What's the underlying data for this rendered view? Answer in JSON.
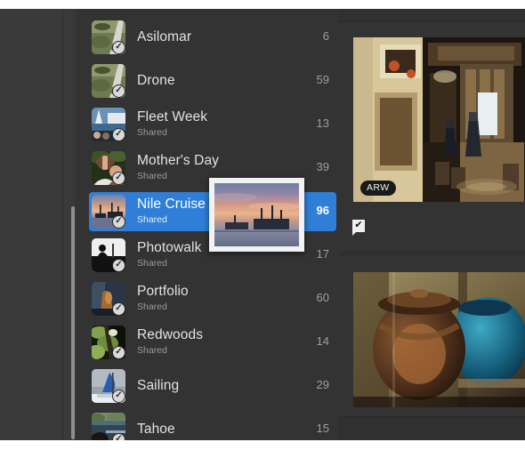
{
  "app": {
    "theme_bg": "#333333",
    "accent": "#2f7fd8",
    "panel_bg": "#3a3a3a"
  },
  "sidebar": {
    "name": "album-list",
    "scrollbar": {
      "name": "vertical-scrollbar"
    },
    "albums": [
      {
        "title": "Asilomar",
        "subtitle": "",
        "count": "6",
        "selected": false,
        "shared_check": true,
        "thumb": "trail"
      },
      {
        "title": "Drone",
        "subtitle": "",
        "count": "59",
        "selected": false,
        "shared_check": true,
        "thumb": "trail"
      },
      {
        "title": "Fleet Week",
        "subtitle": "Shared",
        "count": "13",
        "selected": false,
        "shared_check": true,
        "thumb": "boat"
      },
      {
        "title": "Mother's Day",
        "subtitle": "Shared",
        "count": "39",
        "selected": false,
        "shared_check": true,
        "thumb": "portrait"
      },
      {
        "title": "Nile Cruise",
        "subtitle": "Shared",
        "count": "96",
        "selected": true,
        "shared_check": true,
        "thumb": "sunsetboat"
      },
      {
        "title": "Photowalk",
        "subtitle": "Shared",
        "count": "17",
        "selected": false,
        "shared_check": true,
        "thumb": "bw"
      },
      {
        "title": "Portfolio",
        "subtitle": "Shared",
        "count": "60",
        "selected": false,
        "shared_check": true,
        "thumb": "cliff"
      },
      {
        "title": "Redwoods",
        "subtitle": "Shared",
        "count": "14",
        "selected": false,
        "shared_check": true,
        "thumb": "forest"
      },
      {
        "title": "Sailing",
        "subtitle": "",
        "count": "29",
        "selected": false,
        "shared_check": true,
        "thumb": "sail"
      },
      {
        "title": "Tahoe",
        "subtitle": "",
        "count": "15",
        "selected": false,
        "shared_check": true,
        "thumb": "lake"
      }
    ]
  },
  "drag_preview": {
    "name": "drag-thumbnail",
    "alt": "sunset harbor boat photo"
  },
  "grid": {
    "cells": [
      {
        "name": "photo-cell-1",
        "alt": "museum interior doorway with people",
        "format_badge": "ARW",
        "flag_checked": true
      },
      {
        "name": "photo-cell-2",
        "alt": "ornate bronze and blue urns",
        "format_badge": "",
        "flag_checked": false
      }
    ]
  },
  "toolbar": {
    "name": "grid-view-toolbar",
    "buttons": [
      {
        "name": "compare-view-button",
        "icon": "compare-icon",
        "active": false
      },
      {
        "name": "grid-view-button",
        "icon": "grid-icon",
        "active": true
      },
      {
        "name": "filmstrip-view-button",
        "icon": "filmstrip-icon",
        "active": false
      },
      {
        "name": "detail-list-button",
        "icon": "list-lines-icon",
        "active": false
      }
    ]
  }
}
